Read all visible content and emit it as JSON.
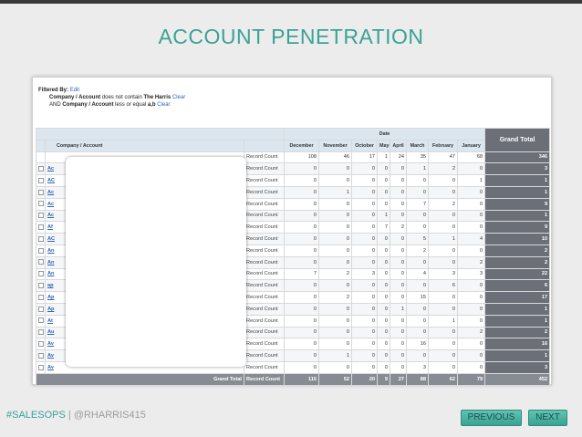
{
  "slide": {
    "title": "ACCOUNT PENETRATION"
  },
  "filters": {
    "filtered_by": "Filtered By:",
    "edit": "Edit",
    "line1_field": "Company / Account",
    "line1_op": "does not contain",
    "line1_value": "The Harris",
    "line1_clear": "Clear",
    "line2_prefix": "AND",
    "line2_field": "Company / Account",
    "line2_op": "less or equal",
    "line2_value": "a,b",
    "line2_clear": "Clear"
  },
  "report": {
    "date_header": "Date",
    "company_header": "Company / Account",
    "grand_total_header": "Grand Total",
    "months": [
      "December",
      "November",
      "October",
      "May",
      "April",
      "March",
      "February",
      "January"
    ],
    "summary_row": {
      "label": "Record Count",
      "values": [
        "108",
        "46",
        "17",
        "1",
        "24",
        "35",
        "47",
        "68"
      ],
      "total": "346"
    },
    "rows": [
      {
        "acct": "Ac",
        "label": "Record Count",
        "values": [
          "0",
          "0",
          "0",
          "0",
          "0",
          "1",
          "2",
          "0"
        ],
        "total": "3"
      },
      {
        "acct": "AC",
        "label": "Record Count",
        "values": [
          "0",
          "0",
          "0",
          "0",
          "0",
          "0",
          "0",
          "1"
        ],
        "total": "1"
      },
      {
        "acct": "Ac",
        "label": "Record Count",
        "values": [
          "0",
          "1",
          "0",
          "0",
          "0",
          "0",
          "0",
          "0"
        ],
        "total": "1"
      },
      {
        "acct": "Ac",
        "label": "Record Count",
        "values": [
          "0",
          "0",
          "0",
          "0",
          "0",
          "7",
          "2",
          "0"
        ],
        "total": "9"
      },
      {
        "acct": "Ac",
        "label": "Record Count",
        "values": [
          "0",
          "0",
          "0",
          "1",
          "0",
          "0",
          "0",
          "0"
        ],
        "total": "1"
      },
      {
        "acct": "Af",
        "label": "Record Count",
        "values": [
          "0",
          "0",
          "0",
          "7",
          "2",
          "0",
          "0",
          "0"
        ],
        "total": "9"
      },
      {
        "acct": "AC",
        "label": "Record Count",
        "values": [
          "0",
          "0",
          "0",
          "0",
          "0",
          "5",
          "1",
          "4"
        ],
        "total": "10"
      },
      {
        "acct": "An",
        "label": "Record Count",
        "values": [
          "0",
          "0",
          "0",
          "0",
          "0",
          "2",
          "0",
          "0"
        ],
        "total": "2"
      },
      {
        "acct": "An",
        "label": "Record Count",
        "values": [
          "0",
          "0",
          "0",
          "0",
          "0",
          "0",
          "0",
          "2"
        ],
        "total": "2"
      },
      {
        "acct": "An",
        "label": "Record Count",
        "values": [
          "7",
          "2",
          "3",
          "0",
          "0",
          "4",
          "3",
          "3"
        ],
        "total": "22"
      },
      {
        "acct": "ap",
        "label": "Record Count",
        "values": [
          "0",
          "0",
          "0",
          "0",
          "0",
          "0",
          "6",
          "0"
        ],
        "total": "6"
      },
      {
        "acct": "Ap",
        "label": "Record Count",
        "values": [
          "0",
          "2",
          "0",
          "0",
          "0",
          "15",
          "0",
          "0"
        ],
        "total": "17"
      },
      {
        "acct": "Ap",
        "label": "Record Count",
        "values": [
          "0",
          "0",
          "0",
          "0",
          "1",
          "0",
          "0",
          "0"
        ],
        "total": "1"
      },
      {
        "acct": "At",
        "label": "Record Count",
        "values": [
          "0",
          "0",
          "0",
          "0",
          "0",
          "0",
          "1",
          "0"
        ],
        "total": "1"
      },
      {
        "acct": "Au",
        "label": "Record Count",
        "values": [
          "0",
          "0",
          "0",
          "0",
          "0",
          "0",
          "0",
          "2"
        ],
        "total": "2"
      },
      {
        "acct": "Av",
        "label": "Record Count",
        "values": [
          "0",
          "0",
          "0",
          "0",
          "0",
          "16",
          "0",
          "0"
        ],
        "total": "16"
      },
      {
        "acct": "Av",
        "label": "Record Count",
        "values": [
          "0",
          "1",
          "0",
          "0",
          "0",
          "0",
          "0",
          "0"
        ],
        "total": "1"
      },
      {
        "acct": "Av",
        "label": "Record Count",
        "values": [
          "0",
          "0",
          "0",
          "0",
          "0",
          "3",
          "0",
          "0"
        ],
        "total": "3"
      }
    ],
    "grand_total_row": {
      "label": "Grand Total",
      "sublabel": "Record Count",
      "values": [
        "115",
        "52",
        "20",
        "9",
        "27",
        "88",
        "62",
        "79"
      ],
      "total": "452"
    }
  },
  "footer": {
    "hashtag": "#SALESOPS",
    "separator": "|",
    "handle": "@RHARRIS415"
  },
  "nav": {
    "previous": "PREVIOUS",
    "next": "NEXT"
  },
  "colors": {
    "accent": "#3aa394",
    "link": "#2d64b1",
    "grand_total_bg": "#6a6f78"
  }
}
